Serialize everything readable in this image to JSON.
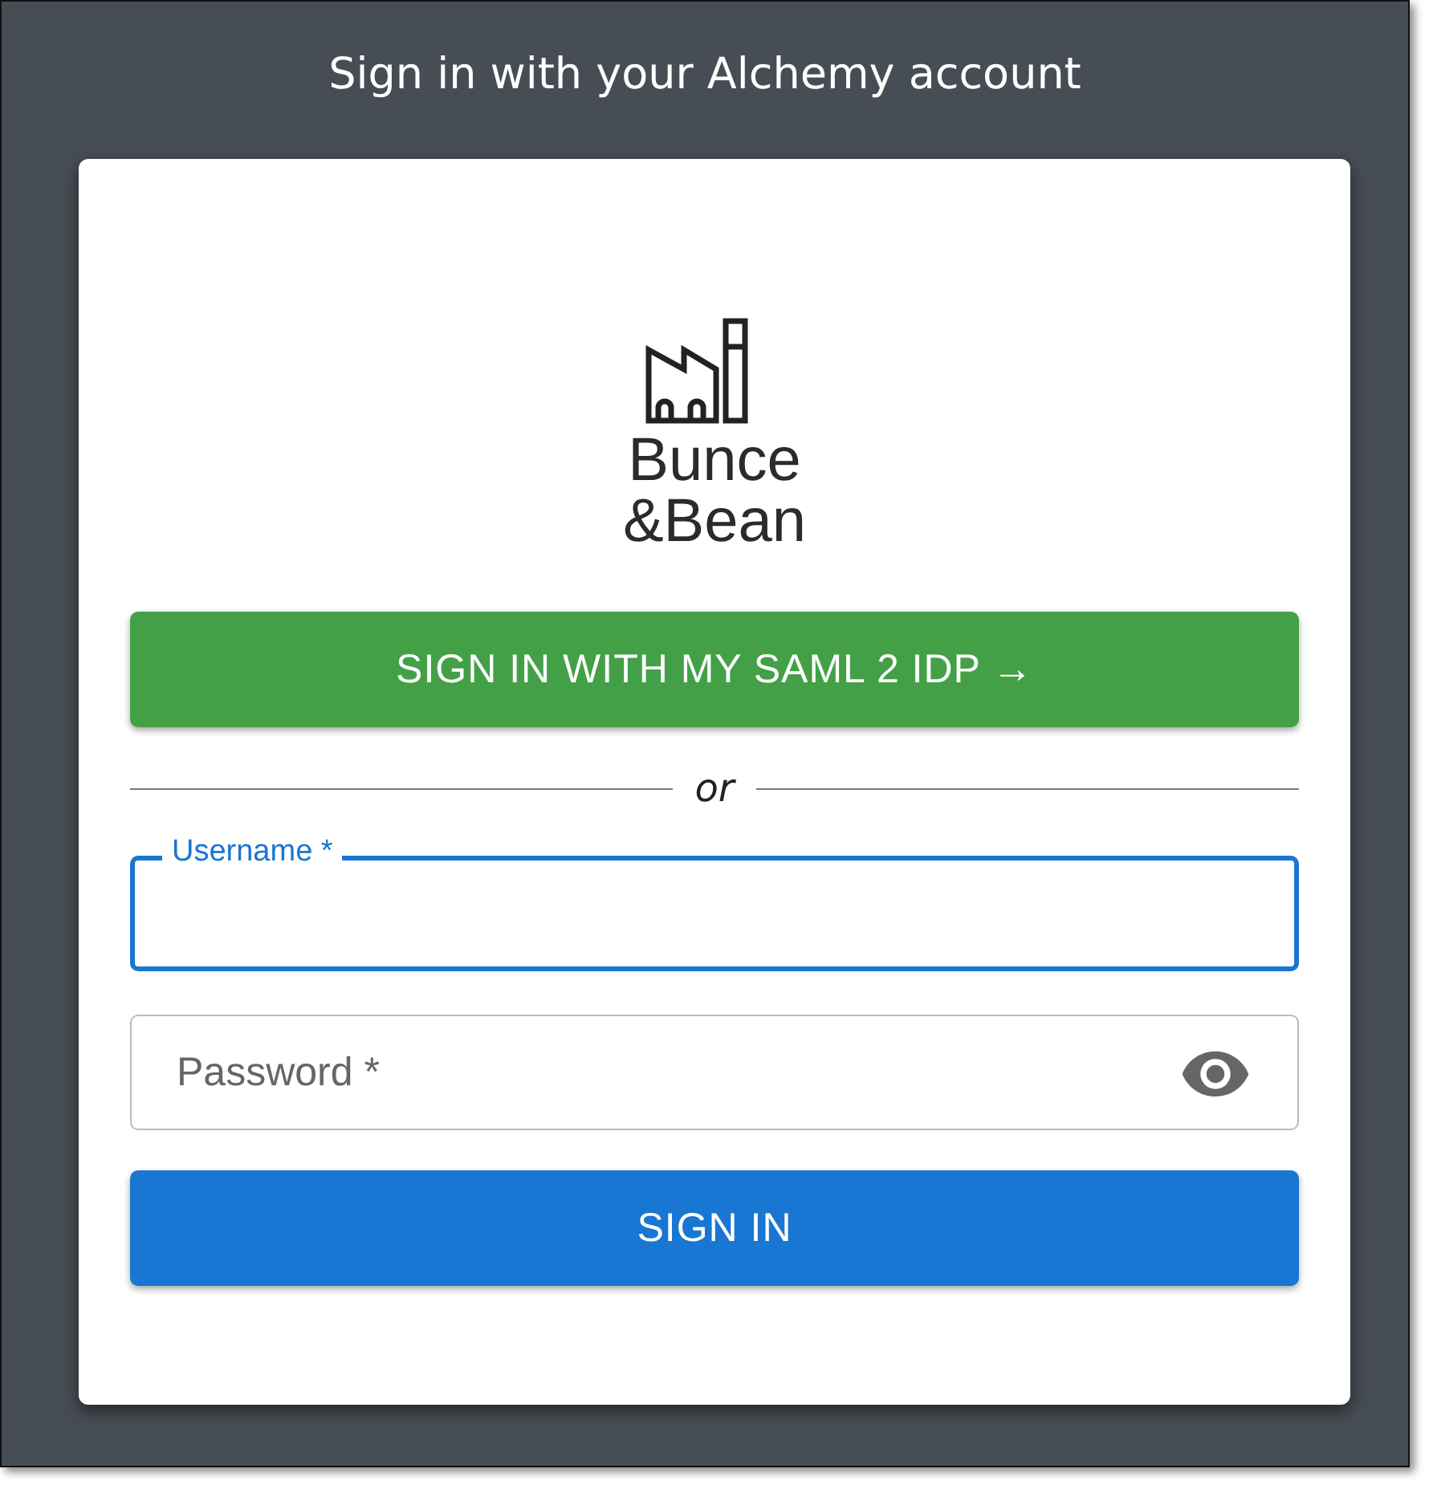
{
  "heading": "Sign in with your Alchemy account",
  "logo": {
    "lines": [
      "Bunce",
      "&Bean"
    ]
  },
  "sso_button": {
    "label": "SIGN IN WITH MY SAML 2 IDP →"
  },
  "divider": {
    "label": "or"
  },
  "fields": [
    {
      "kind": "text",
      "label": "Username *",
      "focused": true
    },
    {
      "kind": "password",
      "label": "Password *",
      "focused": false
    }
  ],
  "submit_button": {
    "label": "SIGN IN"
  }
}
